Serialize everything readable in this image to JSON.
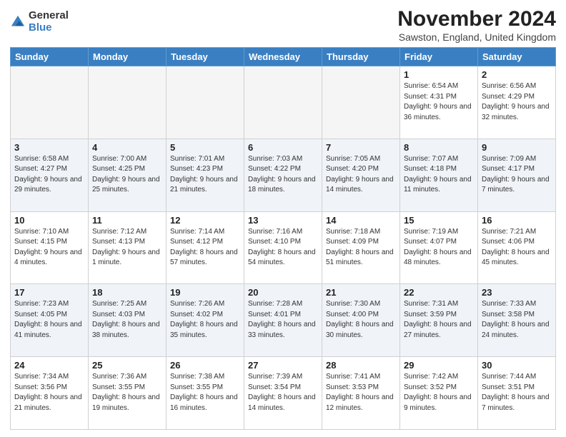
{
  "header": {
    "logo_general": "General",
    "logo_blue": "Blue",
    "month_title": "November 2024",
    "location": "Sawston, England, United Kingdom"
  },
  "weekdays": [
    "Sunday",
    "Monday",
    "Tuesday",
    "Wednesday",
    "Thursday",
    "Friday",
    "Saturday"
  ],
  "weeks": [
    [
      {
        "day": "",
        "info": ""
      },
      {
        "day": "",
        "info": ""
      },
      {
        "day": "",
        "info": ""
      },
      {
        "day": "",
        "info": ""
      },
      {
        "day": "",
        "info": ""
      },
      {
        "day": "1",
        "info": "Sunrise: 6:54 AM\nSunset: 4:31 PM\nDaylight: 9 hours and 36 minutes."
      },
      {
        "day": "2",
        "info": "Sunrise: 6:56 AM\nSunset: 4:29 PM\nDaylight: 9 hours and 32 minutes."
      }
    ],
    [
      {
        "day": "3",
        "info": "Sunrise: 6:58 AM\nSunset: 4:27 PM\nDaylight: 9 hours and 29 minutes."
      },
      {
        "day": "4",
        "info": "Sunrise: 7:00 AM\nSunset: 4:25 PM\nDaylight: 9 hours and 25 minutes."
      },
      {
        "day": "5",
        "info": "Sunrise: 7:01 AM\nSunset: 4:23 PM\nDaylight: 9 hours and 21 minutes."
      },
      {
        "day": "6",
        "info": "Sunrise: 7:03 AM\nSunset: 4:22 PM\nDaylight: 9 hours and 18 minutes."
      },
      {
        "day": "7",
        "info": "Sunrise: 7:05 AM\nSunset: 4:20 PM\nDaylight: 9 hours and 14 minutes."
      },
      {
        "day": "8",
        "info": "Sunrise: 7:07 AM\nSunset: 4:18 PM\nDaylight: 9 hours and 11 minutes."
      },
      {
        "day": "9",
        "info": "Sunrise: 7:09 AM\nSunset: 4:17 PM\nDaylight: 9 hours and 7 minutes."
      }
    ],
    [
      {
        "day": "10",
        "info": "Sunrise: 7:10 AM\nSunset: 4:15 PM\nDaylight: 9 hours and 4 minutes."
      },
      {
        "day": "11",
        "info": "Sunrise: 7:12 AM\nSunset: 4:13 PM\nDaylight: 9 hours and 1 minute."
      },
      {
        "day": "12",
        "info": "Sunrise: 7:14 AM\nSunset: 4:12 PM\nDaylight: 8 hours and 57 minutes."
      },
      {
        "day": "13",
        "info": "Sunrise: 7:16 AM\nSunset: 4:10 PM\nDaylight: 8 hours and 54 minutes."
      },
      {
        "day": "14",
        "info": "Sunrise: 7:18 AM\nSunset: 4:09 PM\nDaylight: 8 hours and 51 minutes."
      },
      {
        "day": "15",
        "info": "Sunrise: 7:19 AM\nSunset: 4:07 PM\nDaylight: 8 hours and 48 minutes."
      },
      {
        "day": "16",
        "info": "Sunrise: 7:21 AM\nSunset: 4:06 PM\nDaylight: 8 hours and 45 minutes."
      }
    ],
    [
      {
        "day": "17",
        "info": "Sunrise: 7:23 AM\nSunset: 4:05 PM\nDaylight: 8 hours and 41 minutes."
      },
      {
        "day": "18",
        "info": "Sunrise: 7:25 AM\nSunset: 4:03 PM\nDaylight: 8 hours and 38 minutes."
      },
      {
        "day": "19",
        "info": "Sunrise: 7:26 AM\nSunset: 4:02 PM\nDaylight: 8 hours and 35 minutes."
      },
      {
        "day": "20",
        "info": "Sunrise: 7:28 AM\nSunset: 4:01 PM\nDaylight: 8 hours and 33 minutes."
      },
      {
        "day": "21",
        "info": "Sunrise: 7:30 AM\nSunset: 4:00 PM\nDaylight: 8 hours and 30 minutes."
      },
      {
        "day": "22",
        "info": "Sunrise: 7:31 AM\nSunset: 3:59 PM\nDaylight: 8 hours and 27 minutes."
      },
      {
        "day": "23",
        "info": "Sunrise: 7:33 AM\nSunset: 3:58 PM\nDaylight: 8 hours and 24 minutes."
      }
    ],
    [
      {
        "day": "24",
        "info": "Sunrise: 7:34 AM\nSunset: 3:56 PM\nDaylight: 8 hours and 21 minutes."
      },
      {
        "day": "25",
        "info": "Sunrise: 7:36 AM\nSunset: 3:55 PM\nDaylight: 8 hours and 19 minutes."
      },
      {
        "day": "26",
        "info": "Sunrise: 7:38 AM\nSunset: 3:55 PM\nDaylight: 8 hours and 16 minutes."
      },
      {
        "day": "27",
        "info": "Sunrise: 7:39 AM\nSunset: 3:54 PM\nDaylight: 8 hours and 14 minutes."
      },
      {
        "day": "28",
        "info": "Sunrise: 7:41 AM\nSunset: 3:53 PM\nDaylight: 8 hours and 12 minutes."
      },
      {
        "day": "29",
        "info": "Sunrise: 7:42 AM\nSunset: 3:52 PM\nDaylight: 8 hours and 9 minutes."
      },
      {
        "day": "30",
        "info": "Sunrise: 7:44 AM\nSunset: 3:51 PM\nDaylight: 8 hours and 7 minutes."
      }
    ]
  ]
}
